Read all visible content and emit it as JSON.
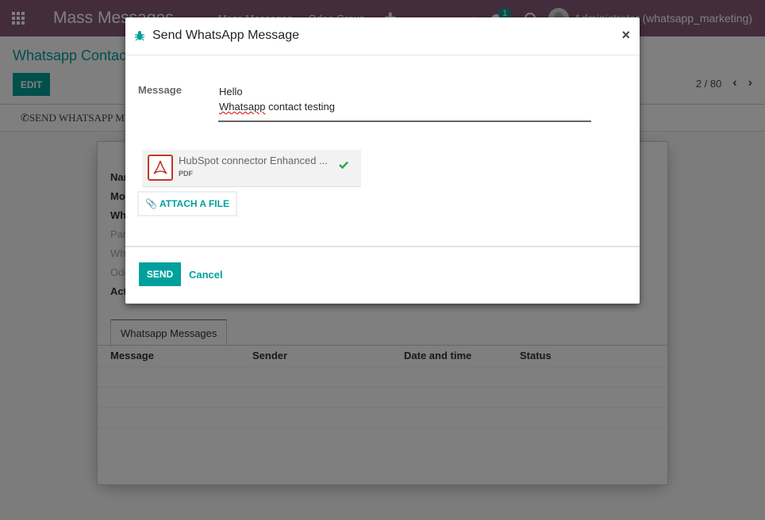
{
  "navbar": {
    "brand": "Mass Messages",
    "menu": [
      "Mass Messages",
      "Odoo Group"
    ],
    "chat_badge": "1",
    "user": "Administrator (whatsapp_marketing)"
  },
  "control_panel": {
    "breadcrumb": "Whatsapp Contacts",
    "edit_label": "EDIT",
    "pager": "2 / 80",
    "send_whatsapp_label": "SEND WHATSAPP MESSAGE"
  },
  "form": {
    "fields": [
      {
        "label": "Name",
        "muted": false
      },
      {
        "label": "Mobile",
        "muted": false
      },
      {
        "label": "Whatsapp",
        "muted": false
      },
      {
        "label": "Partner",
        "muted": true
      },
      {
        "label": "Whatsapp",
        "muted": true
      },
      {
        "label": "Odoo",
        "muted": true
      },
      {
        "label": "Active",
        "muted": false
      }
    ],
    "tab_label": "Whatsapp Messages",
    "columns": [
      "Message",
      "Sender",
      "Date and time",
      "Status"
    ]
  },
  "modal": {
    "title": "Send WhatsApp Message",
    "message_label": "Message",
    "message_line1": "Hello",
    "message_line2_word": "Whatsapp",
    "message_line2_rest": " contact testing",
    "attachment": {
      "name": "HubSpot connector Enhanced ...",
      "ext": "PDF"
    },
    "attach_label": "ATTACH A FILE",
    "send_label": "SEND",
    "cancel_label": "Cancel"
  },
  "colors": {
    "primary": "#00a09d",
    "navbar": "#875a7b",
    "pdf": "#c0392b",
    "check": "#28a745"
  }
}
